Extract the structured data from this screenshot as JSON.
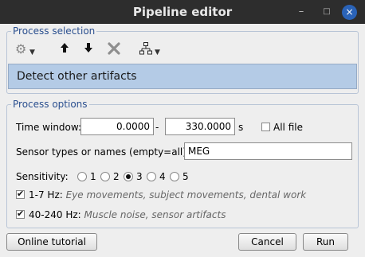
{
  "window": {
    "title": "Pipeline editor"
  },
  "titlebar_buttons": {
    "minimize_glyph": "–",
    "maximize_glyph": "□",
    "close_glyph": "×"
  },
  "process_selection": {
    "legend": "Process selection",
    "toolbar": [
      "gear-icon",
      "arrow-up-icon",
      "arrow-down-icon",
      "delete-icon",
      "pipeline-tree-icon"
    ],
    "selected_process": "Detect other artifacts",
    "selected_color": "#b4cbe6"
  },
  "process_options": {
    "legend": "Process options",
    "time_window": {
      "label": "Time window:",
      "start": "0.0000",
      "separator": "-",
      "end": "330.0000",
      "unit": "s",
      "all_file_label": "All file",
      "all_file_checked": false
    },
    "sensor": {
      "label": "Sensor types or names (empty=all):",
      "value": "MEG"
    },
    "sensitivity": {
      "label": "Sensitivity:",
      "options": [
        "1",
        "2",
        "3",
        "4",
        "5"
      ],
      "selected": "3"
    },
    "band1": {
      "checked": true,
      "label": "1-7 Hz:",
      "description": "Eye movements, subject movements, dental work"
    },
    "band2": {
      "checked": true,
      "label": "40-240 Hz:",
      "description": "Muscle noise, sensor artifacts"
    }
  },
  "footer": {
    "tutorial_label": "Online tutorial",
    "cancel_label": "Cancel",
    "run_label": "Run"
  }
}
